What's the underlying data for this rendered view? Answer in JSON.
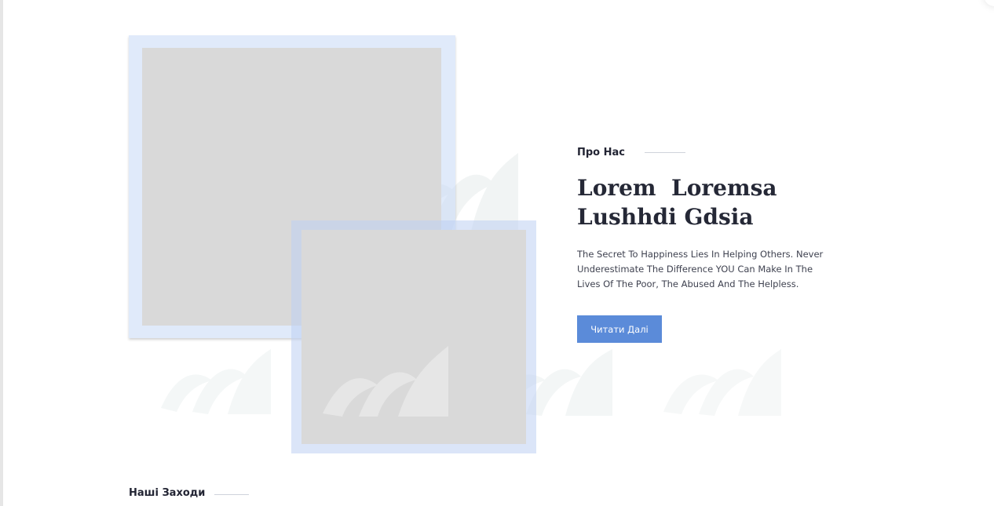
{
  "about": {
    "eyebrow": "Про Нас",
    "title": "Lorem  Loremsa Lushhdi Gdsia",
    "description": "The Secret To Happiness Lies In Helping Others. Never Underestimate The Difference YOU Can Make In The Lives Of The Poor, The Abused And The Helpless.",
    "read_more_label": "Читати Далі"
  },
  "events": {
    "heading": "Наші Заходи"
  },
  "colors": {
    "accent": "#5b8bd9",
    "frame": "#dce7f9",
    "placeholder": "#d9d9d9",
    "heading": "#252836",
    "body_text": "#3f4250"
  },
  "icons": {
    "decoration": "leaf-icon",
    "image_placeholder": "image-placeholder-icon"
  }
}
